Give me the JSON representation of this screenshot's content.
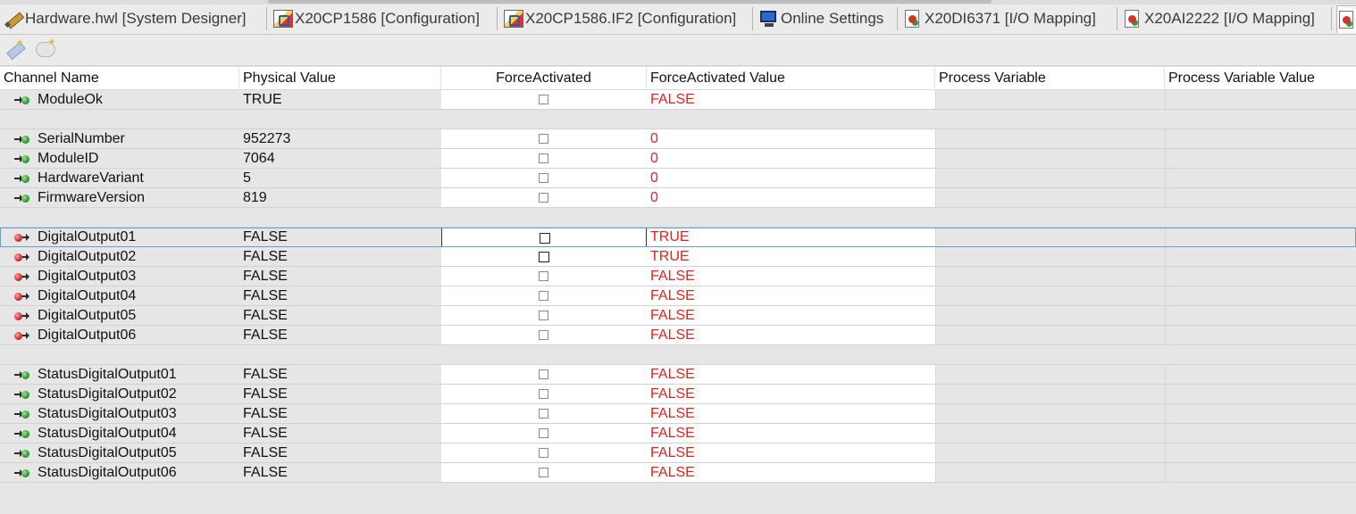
{
  "tabs": [
    {
      "label": "Hardware.hwl [System Designer]",
      "icon": "pencil-icon"
    },
    {
      "label": "X20CP1586 [Configuration]",
      "icon": "configuration-icon"
    },
    {
      "label": "X20CP1586.IF2 [Configuration]",
      "icon": "configuration-icon"
    },
    {
      "label": "Online Settings",
      "icon": "monitor-icon"
    },
    {
      "label": "X20DI6371 [I/O Mapping]",
      "icon": "io-mapping-icon"
    },
    {
      "label": "X20AI2222 [I/O Mapping]",
      "icon": "io-mapping-icon"
    }
  ],
  "columns": {
    "channel_name": "Channel Name",
    "physical_value": "Physical Value",
    "force_activated": "ForceActivated",
    "force_activated_value": "ForceActivated Value",
    "process_variable": "Process Variable",
    "process_variable_value": "Process Variable Value"
  },
  "rows": [
    {
      "name": "ModuleOk",
      "dir": "in",
      "physical": "TRUE",
      "force_value": "FALSE"
    },
    {
      "spacer": true
    },
    {
      "name": "SerialNumber",
      "dir": "in",
      "physical": "952273",
      "force_value": "0"
    },
    {
      "name": "ModuleID",
      "dir": "in",
      "physical": "7064",
      "force_value": "0"
    },
    {
      "name": "HardwareVariant",
      "dir": "in",
      "physical": "5",
      "force_value": "0"
    },
    {
      "name": "FirmwareVersion",
      "dir": "in",
      "physical": "819",
      "force_value": "0"
    },
    {
      "spacer": true
    },
    {
      "name": "DigitalOutput01",
      "dir": "out",
      "physical": "FALSE",
      "force_value": "TRUE",
      "selected": true
    },
    {
      "name": "DigitalOutput02",
      "dir": "out",
      "physical": "FALSE",
      "force_value": "TRUE"
    },
    {
      "name": "DigitalOutput03",
      "dir": "out",
      "physical": "FALSE",
      "force_value": "FALSE"
    },
    {
      "name": "DigitalOutput04",
      "dir": "out",
      "physical": "FALSE",
      "force_value": "FALSE"
    },
    {
      "name": "DigitalOutput05",
      "dir": "out",
      "physical": "FALSE",
      "force_value": "FALSE"
    },
    {
      "name": "DigitalOutput06",
      "dir": "out",
      "physical": "FALSE",
      "force_value": "FALSE"
    },
    {
      "spacer": true
    },
    {
      "name": "StatusDigitalOutput01",
      "dir": "in",
      "physical": "FALSE",
      "force_value": "FALSE"
    },
    {
      "name": "StatusDigitalOutput02",
      "dir": "in",
      "physical": "FALSE",
      "force_value": "FALSE"
    },
    {
      "name": "StatusDigitalOutput03",
      "dir": "in",
      "physical": "FALSE",
      "force_value": "FALSE"
    },
    {
      "name": "StatusDigitalOutput04",
      "dir": "in",
      "physical": "FALSE",
      "force_value": "FALSE"
    },
    {
      "name": "StatusDigitalOutput05",
      "dir": "in",
      "physical": "FALSE",
      "force_value": "FALSE"
    },
    {
      "name": "StatusDigitalOutput06",
      "dir": "in",
      "physical": "FALSE",
      "force_value": "FALSE"
    }
  ],
  "colors": {
    "force_value_text": "#e0231d",
    "selection_border": "#6f9fc8"
  }
}
